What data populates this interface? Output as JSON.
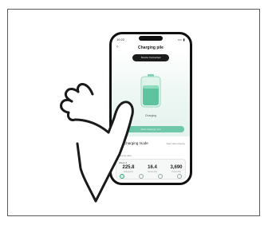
{
  "status_bar": {
    "time": "10:22",
    "signal": "••• ▮"
  },
  "header": {
    "back_glyph": "‹",
    "title": "Charging pile"
  },
  "hero": {
    "pill_label": "Device Connected",
    "battery_status": "Charging",
    "start_button": "Start charging now"
  },
  "charging_mode": {
    "label": "Charging mode",
    "value": "Start after display"
  },
  "section_label": "Charging data",
  "stats": {
    "heading": "Week 4",
    "items": [
      {
        "value": "225.8",
        "unit": "Voltage(V)"
      },
      {
        "value": "16.4",
        "unit": "Current(A)"
      },
      {
        "value": "3,690",
        "unit": "Power(W)"
      }
    ]
  },
  "colors": {
    "accent": "#6ec7a8",
    "frame": "#5a5a5a",
    "phone_body": "#111111"
  },
  "icons": [
    "battery-icon",
    "checkbox-icon",
    "home-icon",
    "device-icon",
    "settings-icon",
    "profile-icon",
    "hand-icon"
  ]
}
